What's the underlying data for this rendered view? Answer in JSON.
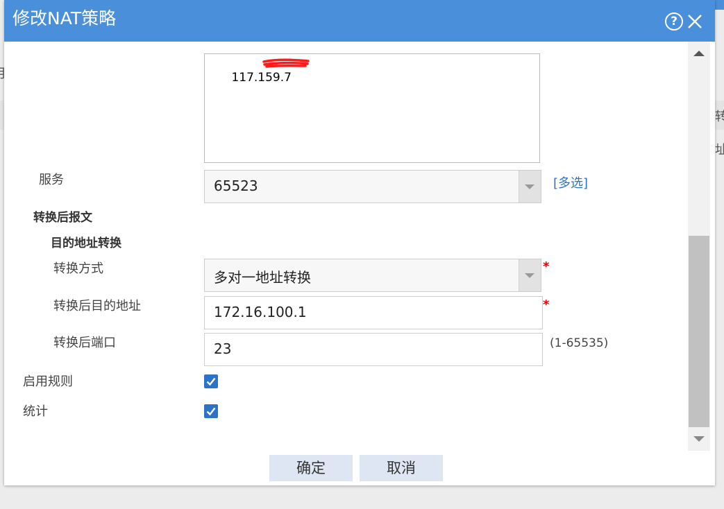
{
  "dialog": {
    "title": "修改NAT策略",
    "help_icon": "question-circle-icon",
    "close_icon": "close-icon"
  },
  "background": {
    "fragments": [
      "月",
      "转",
      "址"
    ]
  },
  "form": {
    "destination_address_value": "117.159.7",
    "service": {
      "label": "服务",
      "value": "65523",
      "multi_select_link": "[多选]"
    },
    "translated_packet_header": "转换后报文",
    "dest_nat_header": "目的地址转换",
    "translation_mode": {
      "label": "转换方式",
      "value": "多对一地址转换",
      "required_mark": "*"
    },
    "translated_dest_address": {
      "label": "转换后目的地址",
      "value": "172.16.100.1",
      "required_mark": "*"
    },
    "translated_port": {
      "label": "转换后端口",
      "value": "23",
      "hint": "(1-65535)"
    },
    "enable_rule": {
      "label": "启用规则",
      "checked": true
    },
    "statistics": {
      "label": "统计",
      "checked": true
    }
  },
  "buttons": {
    "ok": "确定",
    "cancel": "取消"
  },
  "colors": {
    "titlebar": "#4a8fd9",
    "link": "#2c72c7",
    "required": "#e00000",
    "checkbox": "#2c72c7",
    "button_bg": "#dde6f2"
  }
}
